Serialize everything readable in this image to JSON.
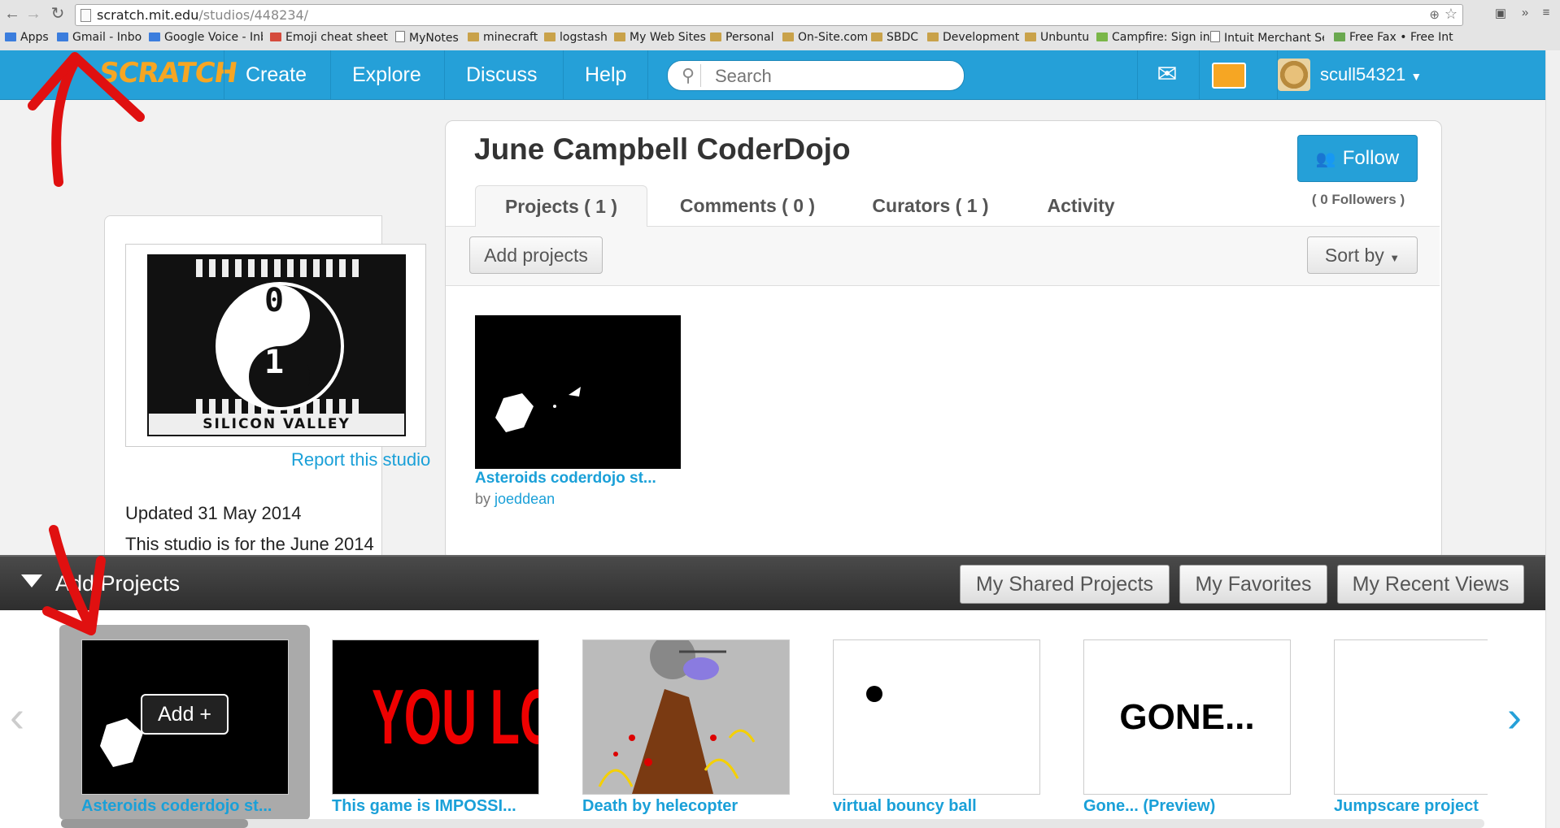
{
  "browser": {
    "url_host": "scratch.mit.edu",
    "url_path": "/studios/448234/",
    "bookmarks": [
      {
        "label": "Apps",
        "icon": "apps-icon"
      },
      {
        "label": "Gmail - Inbox",
        "icon": "google-icon"
      },
      {
        "label": "Google Voice - Inbo",
        "icon": "google-voice-icon"
      },
      {
        "label": "Emoji cheat sheet",
        "icon": "emoji-icon"
      },
      {
        "label": "MyNotes",
        "icon": "page-icon"
      },
      {
        "label": "minecraft",
        "icon": "folder-icon"
      },
      {
        "label": "logstash",
        "icon": "folder-icon"
      },
      {
        "label": "My Web Sites",
        "icon": "folder-icon"
      },
      {
        "label": "Personal",
        "icon": "folder-icon"
      },
      {
        "label": "On-Site.com",
        "icon": "folder-icon"
      },
      {
        "label": "SBDC",
        "icon": "folder-icon"
      },
      {
        "label": "Development",
        "icon": "folder-icon"
      },
      {
        "label": "Unbuntu",
        "icon": "folder-icon"
      },
      {
        "label": "Campfire: Sign in",
        "icon": "campfire-icon"
      },
      {
        "label": "Intuit Merchant Se",
        "icon": "intuit-icon"
      },
      {
        "label": "Free Fax • Free Int",
        "icon": "fax-icon"
      }
    ]
  },
  "header": {
    "logo": "SCRATCH",
    "nav": [
      "Create",
      "Explore",
      "Discuss",
      "Help"
    ],
    "search_placeholder": "Search",
    "username": "scull54321"
  },
  "studio": {
    "title": "June Campbell CoderDojo",
    "follow_label": "Follow",
    "followers": "( 0 Followers )",
    "tabs": [
      "Projects ( 1 )",
      "Comments ( 0 )",
      "Curators ( 1 )",
      "Activity"
    ],
    "add_projects": "Add projects",
    "sort_by": "Sort by",
    "image_caption": "SILICON VALLEY",
    "image_digits": [
      "0",
      "1"
    ],
    "report": "Report this studio",
    "updated": "Updated 31 May 2014",
    "description": "This studio is for the June 2014",
    "projects": [
      {
        "title": "Asteroids coderdojo st...",
        "by": "by",
        "author": "joeddean"
      }
    ]
  },
  "tray": {
    "title": "Add Projects",
    "buttons": [
      "My Shared Projects",
      "My Favorites",
      "My Recent Views"
    ],
    "add_label": "Add +",
    "items": [
      {
        "title": "Asteroids coderdojo st...",
        "thumb_text": ""
      },
      {
        "title": "This game is IMPOSSI...",
        "thumb_text": "YOU LOSE"
      },
      {
        "title": "Death by helecopter",
        "thumb_text": ""
      },
      {
        "title": "virtual bouncy ball",
        "thumb_text": ""
      },
      {
        "title": "Gone... (Preview)",
        "thumb_text": "GONE..."
      },
      {
        "title": "Jumpscare project",
        "thumb_text": ""
      }
    ]
  },
  "colors": {
    "scratch_blue": "#25a0d8",
    "annotation_red": "#e01010"
  }
}
